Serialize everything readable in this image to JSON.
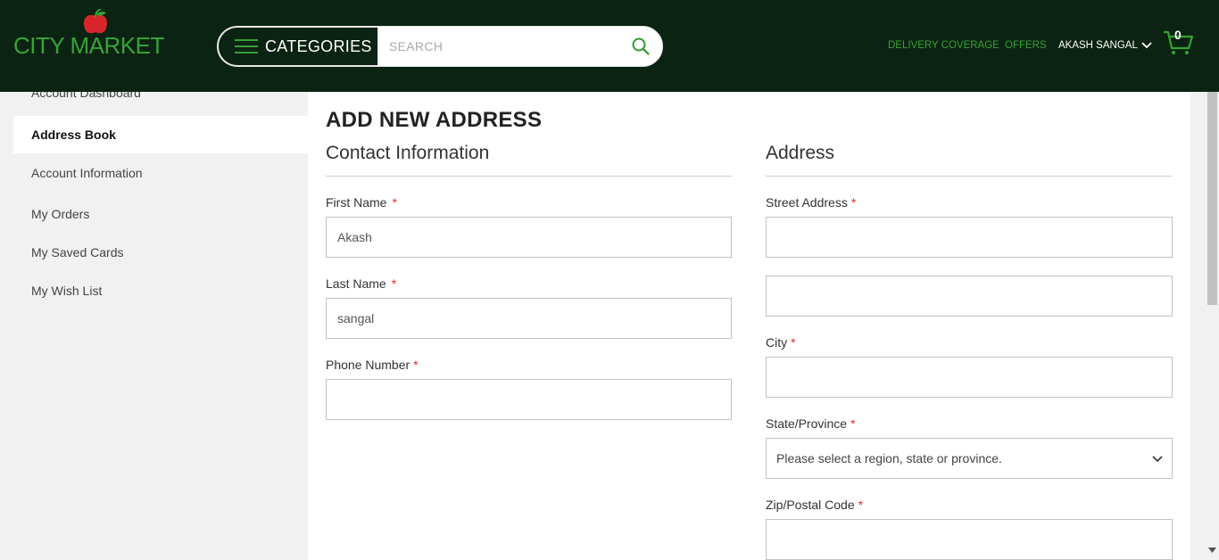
{
  "header": {
    "logo_text": "CITY MARKET",
    "categories_label": "CATEGORIES",
    "search_placeholder": "SEARCH",
    "delivery_label": "DELIVERY COVERAGE",
    "offers_label": "OFFERS",
    "user_label": "AKASH SANGAL",
    "cart_count": "0",
    "colors": {
      "bg": "#0b2312",
      "accent": "#33a333"
    }
  },
  "sidebar": {
    "items": [
      {
        "label": "Account Dashboard",
        "active": false
      },
      {
        "label": "Address Book",
        "active": true
      },
      {
        "label": "Account Information",
        "active": false
      },
      {
        "label": "My Orders",
        "active": false
      },
      {
        "label": "My Saved Cards",
        "active": false
      },
      {
        "label": "My Wish List",
        "active": false
      }
    ]
  },
  "main": {
    "title": "ADD NEW ADDRESS",
    "contact": {
      "heading": "Contact Information",
      "first_name_label": "First Name",
      "first_name_value": "Akash",
      "last_name_label": "Last Name",
      "last_name_value": "sangal",
      "phone_label": "Phone Number",
      "phone_value": ""
    },
    "address": {
      "heading": "Address",
      "street_label": "Street Address",
      "street_line1": "",
      "street_line2": "",
      "city_label": "City",
      "city_value": "",
      "state_label": "State/Province",
      "state_selected": "Please select a region, state or province.",
      "zip_label": "Zip/Postal Code",
      "zip_value": ""
    },
    "required_marker": "*"
  }
}
